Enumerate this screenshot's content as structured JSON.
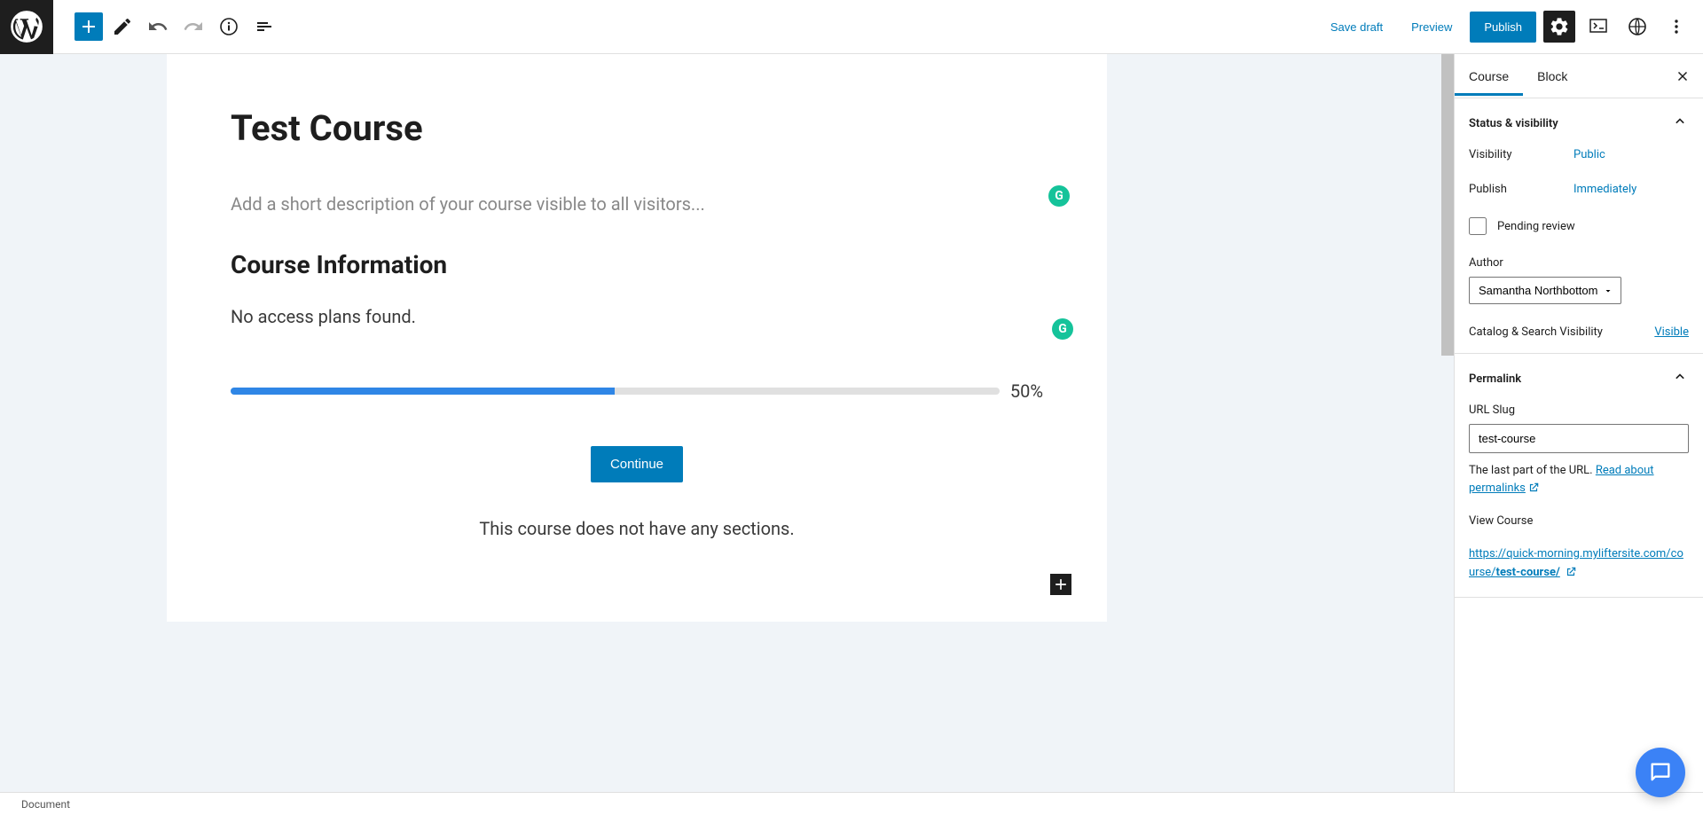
{
  "topbar": {
    "save_draft": "Save draft",
    "preview": "Preview",
    "publish": "Publish"
  },
  "editor": {
    "title": "Test Course",
    "description_placeholder": "Add a short description of your course visible to all visitors...",
    "info_heading": "Course Information",
    "no_access": "No access plans found.",
    "progress_percent": "50%",
    "continue": "Continue",
    "no_sections": "This course does not have any sections."
  },
  "sidebar": {
    "tabs": {
      "course": "Course",
      "block": "Block"
    },
    "status": {
      "title": "Status & visibility",
      "visibility_label": "Visibility",
      "visibility_value": "Public",
      "publish_label": "Publish",
      "publish_value": "Immediately",
      "pending_label": "Pending review",
      "author_label": "Author",
      "author_value": "Samantha Northbottom",
      "catalog_label": "Catalog & Search Visibility",
      "catalog_value": "Visible"
    },
    "permalink": {
      "title": "Permalink",
      "slug_label": "URL Slug",
      "slug_value": "test-course",
      "helper_prefix": "The last part of the URL. ",
      "helper_link": "Read about permalinks",
      "view_label": "View Course",
      "url_prefix": "https://quick-morning.myliftersite.com/course/",
      "url_bold": "test-course/"
    }
  },
  "footer": {
    "document": "Document"
  }
}
